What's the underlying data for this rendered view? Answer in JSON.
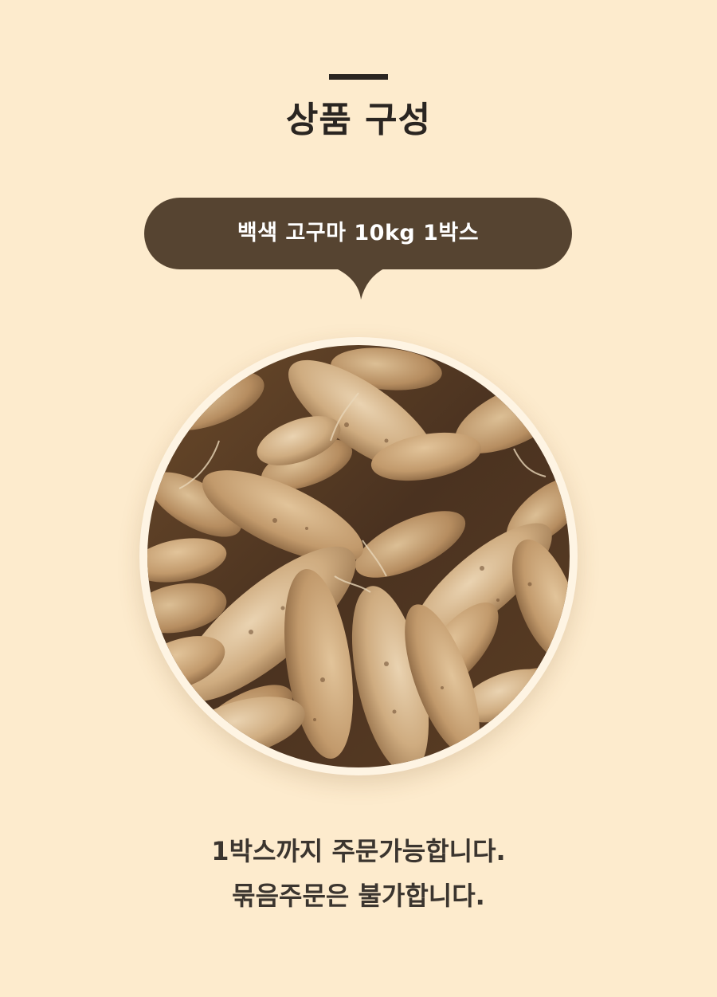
{
  "section": {
    "title": "상품 구성"
  },
  "product": {
    "label": "백색 고구마 10kg 1박스"
  },
  "notes": {
    "line1": "1박스까지 주문가능합니다.",
    "line2": "묶음주문은 불가합니다."
  },
  "colors": {
    "background": "#fdebcd",
    "bubble": "#564431",
    "text_dark": "#2a2521"
  },
  "image": {
    "subject": "sweet-potato-pile"
  }
}
